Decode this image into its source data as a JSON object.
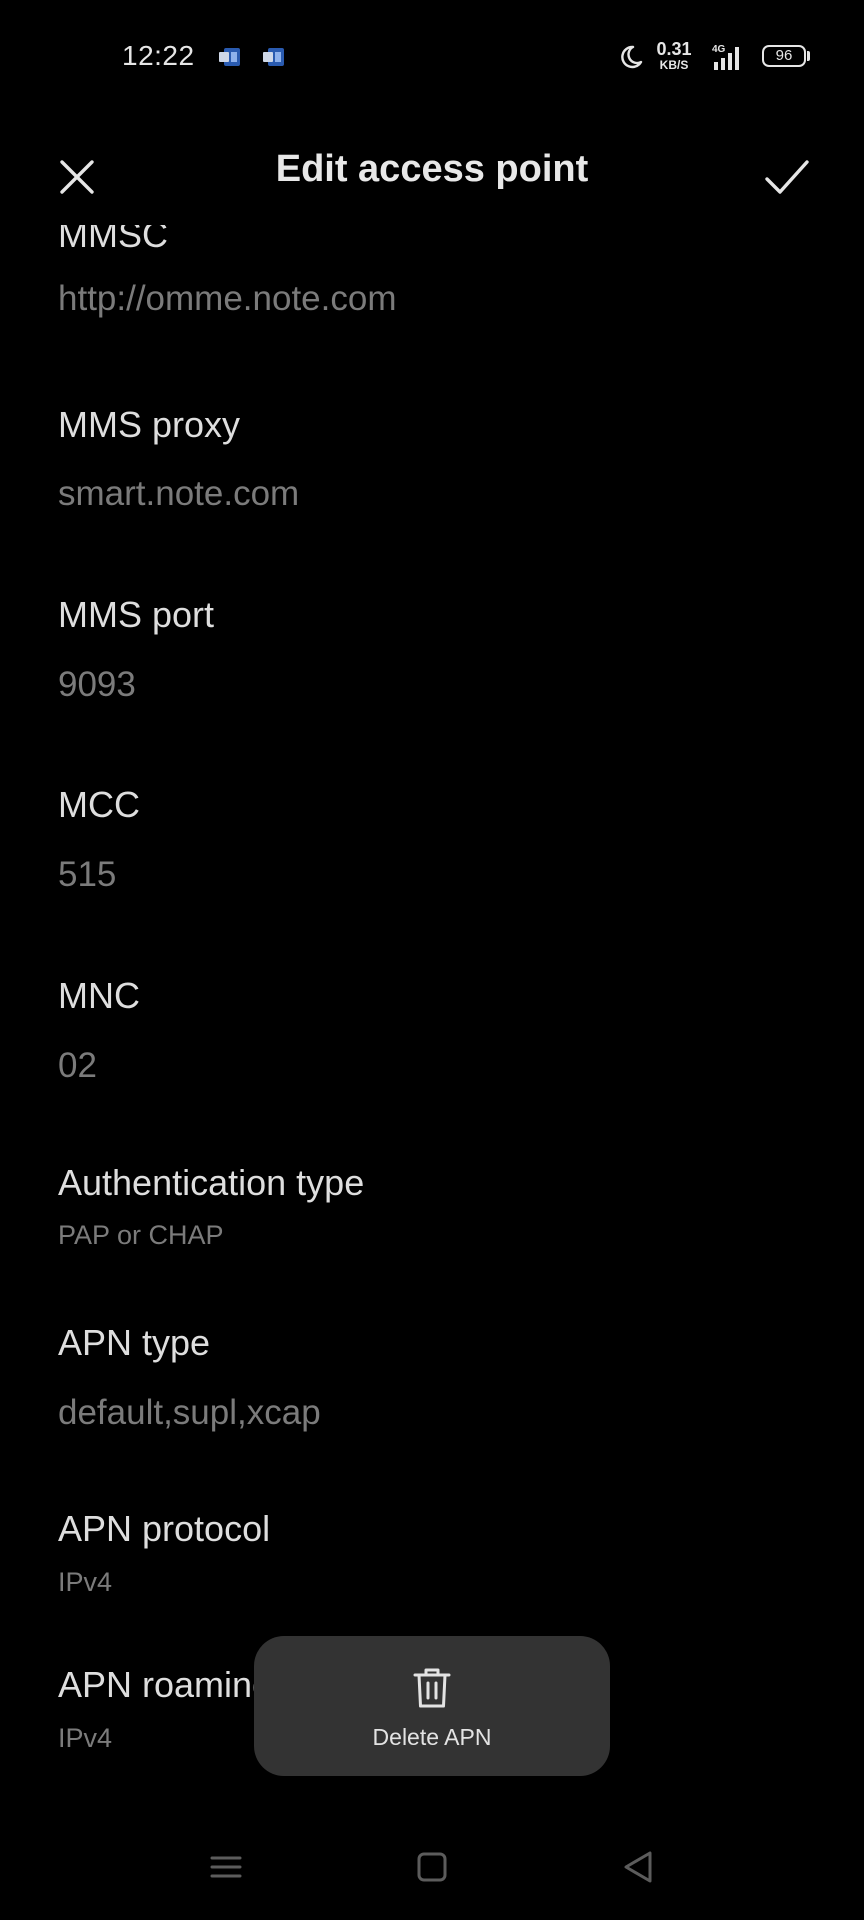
{
  "status_bar": {
    "time": "12:22",
    "network_speed_value": "0.31",
    "network_speed_unit": "KB/S",
    "network_type": "4G",
    "battery_level": "96",
    "icons": [
      "notification-app-icon",
      "notification-app-icon",
      "moon-icon",
      "signal-icon",
      "battery-icon"
    ]
  },
  "header": {
    "title": "Edit access point",
    "close_icon": "close-icon",
    "confirm_icon": "check-icon"
  },
  "fields": [
    {
      "label": "MMSC",
      "value": "http://omme.note.com"
    },
    {
      "label": "MMS proxy",
      "value": "smart.note.com"
    },
    {
      "label": "MMS port",
      "value": "9093"
    },
    {
      "label": "MCC",
      "value": "515"
    },
    {
      "label": "MNC",
      "value": "02"
    },
    {
      "label": "Authentication type",
      "value": "PAP or CHAP"
    },
    {
      "label": "APN type",
      "value": "default,supl,xcap"
    },
    {
      "label": "APN protocol",
      "value": "IPv4"
    },
    {
      "label": "APN roaming protocol",
      "value": "IPv4"
    }
  ],
  "toast": {
    "label": "Delete APN",
    "icon": "trash-icon"
  },
  "nav_bar": {
    "icons": [
      "menu-icon",
      "home-icon",
      "back-icon"
    ]
  },
  "colors": {
    "background": "#000000",
    "label_text": "#dedede",
    "value_text": "#7b7b7b",
    "toast_background": "#333333"
  }
}
